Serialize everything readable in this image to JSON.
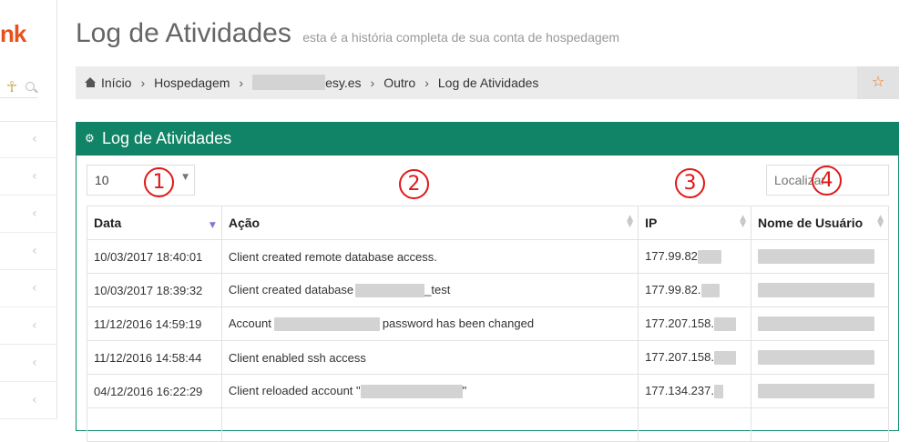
{
  "sidebar": {
    "logo": "nk",
    "ankh": "☥",
    "chevron": "‹"
  },
  "header": {
    "title": "Log de Atividades",
    "subtitle": "esta é a história completa de sua conta de hospedagem"
  },
  "breadcrumb": {
    "home": "Início",
    "hospedagem": "Hospedagem",
    "domain_suffix": "esy.es",
    "outro": "Outro",
    "current": "Log de Atividades",
    "separator": "›",
    "star": "☆"
  },
  "panel": {
    "title": "Log de Atividades",
    "cog": "⚙"
  },
  "controls": {
    "page_size": "10",
    "search_placeholder": "Localizar"
  },
  "markers": [
    "1",
    "2",
    "3",
    "4"
  ],
  "table": {
    "columns": [
      "Data",
      "Ação",
      "IP",
      "Nome de Usuário"
    ],
    "rows": [
      {
        "date": "10/03/2017 18:40:01",
        "action": "Client created remote database access.",
        "ip": "177.99.82"
      },
      {
        "date": "10/03/2017 18:39:32",
        "action_pre": "Client created database",
        "action_post": "_test",
        "ip": "177.99.82."
      },
      {
        "date": "11/12/2016 14:59:19",
        "action_pre": "Account",
        "action_post": "password has been changed",
        "ip": "177.207.158."
      },
      {
        "date": "11/12/2016 14:58:44",
        "action": "Client enabled ssh access",
        "ip": "177.207.158."
      },
      {
        "date": "04/12/2016 16:22:29",
        "action_pre": "Client reloaded account \"",
        "action_post": "\"",
        "ip": "177.134.237."
      }
    ]
  },
  "colors": {
    "panel_header": "#118467",
    "marker": "#e01818",
    "logo": "#e8501c"
  }
}
